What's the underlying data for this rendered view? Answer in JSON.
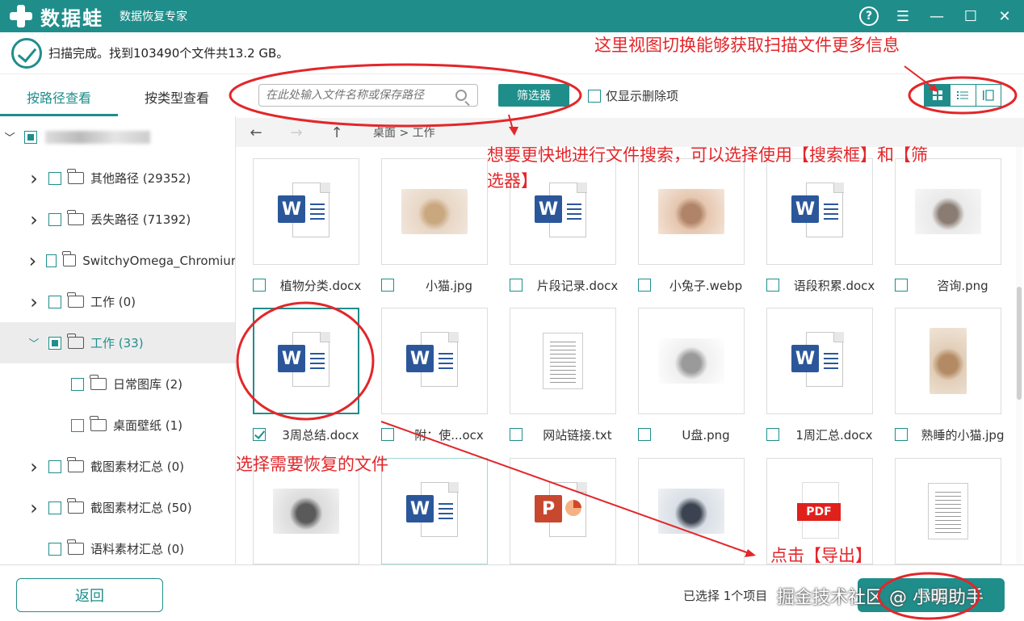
{
  "app": {
    "logo_text": "数据蛙",
    "subtitle": "数据恢复专家",
    "help_label": "?",
    "menu_label": "☰",
    "minimize_label": "—",
    "maximize_label": "☐",
    "close_label": "✕"
  },
  "status": {
    "text": "扫描完成。找到103490个文件共13.2 GB。"
  },
  "left_tabs": [
    {
      "label": "按路径查看",
      "active": true
    },
    {
      "label": "按类型查看",
      "active": false
    }
  ],
  "tree": [
    {
      "label": "",
      "level": 0,
      "expanded": true,
      "check": "partial",
      "blurred": true
    },
    {
      "label": "其他路径 (29352)",
      "level": 1,
      "expanded": false,
      "check": "none"
    },
    {
      "label": "丢失路径 (71392)",
      "level": 1,
      "expanded": false,
      "check": "none"
    },
    {
      "label": "SwitchyOmega_Chromiur",
      "level": 1,
      "expanded": false,
      "check": "none"
    },
    {
      "label": "工作 (0)",
      "level": 1,
      "expanded": false,
      "check": "none"
    },
    {
      "label": "工作 (33)",
      "level": 1,
      "expanded": true,
      "check": "partial",
      "selected": true
    },
    {
      "label": "日常图库 (2)",
      "level": 2,
      "check": "none"
    },
    {
      "label": "桌面壁纸 (1)",
      "level": 2,
      "check": "none"
    },
    {
      "label": "截图素材汇总 (0)",
      "level": 1,
      "expanded": false,
      "check": "none"
    },
    {
      "label": "截图素材汇总 (50)",
      "level": 1,
      "expanded": false,
      "check": "none"
    },
    {
      "label": "语料素材汇总 (0)",
      "level": 1,
      "check": "none"
    }
  ],
  "toolbar": {
    "search_placeholder": "在此处输入文件名称或保存路径",
    "filter_label": "筛选器",
    "deleted_only_label": "仅显示删除项"
  },
  "nav": {
    "back": "←",
    "forward": "→",
    "up": "↑",
    "breadcrumb": "桌面 > 工作"
  },
  "files": [
    {
      "name": "植物分类.docx",
      "type": "word",
      "checked": false
    },
    {
      "name": "小猫.jpg",
      "type": "photo",
      "colors": [
        "#e8d7c6",
        "#c9a77f",
        "#f2e8de"
      ],
      "checked": false
    },
    {
      "name": "片段记录.docx",
      "type": "word",
      "checked": false
    },
    {
      "name": "小兔子.webp",
      "type": "photo",
      "colors": [
        "#e6c7b0",
        "#b08468",
        "#f4e6da"
      ],
      "checked": false
    },
    {
      "name": "语段积累.docx",
      "type": "word",
      "checked": false
    },
    {
      "name": "咨询.png",
      "type": "photo",
      "colors": [
        "#eaeaea",
        "#8a7c72",
        "#f6f6f6"
      ],
      "checked": false
    },
    {
      "name": "3周总结.docx",
      "type": "word",
      "checked": true,
      "selected": true
    },
    {
      "name": "附：使...ocx",
      "type": "word",
      "checked": false
    },
    {
      "name": "网站链接.txt",
      "type": "txt",
      "checked": false
    },
    {
      "name": "U盘.png",
      "type": "photo",
      "colors": [
        "#f0f0f0",
        "#9a9a9a",
        "#ffffff"
      ],
      "checked": false
    },
    {
      "name": "1周汇总.docx",
      "type": "word",
      "checked": false
    },
    {
      "name": "熟睡的小猫.jpg",
      "type": "photo",
      "colors": [
        "#e2cfba",
        "#b38a63",
        "#f0e4d6"
      ],
      "checked": false
    },
    {
      "name": "",
      "type": "photo",
      "colors": [
        "#dcdcdc",
        "#5a5a5a",
        "#f2f2f2"
      ],
      "checked": false
    },
    {
      "name": "",
      "type": "word",
      "checked": false,
      "hover": true
    },
    {
      "name": "",
      "type": "ppt",
      "checked": false
    },
    {
      "name": "",
      "type": "photo",
      "colors": [
        "#d9dfe6",
        "#3b4350",
        "#eef1f4"
      ],
      "checked": false
    },
    {
      "name": "",
      "type": "pdf",
      "checked": false
    },
    {
      "name": "",
      "type": "txt",
      "checked": false
    }
  ],
  "bottom": {
    "back_label": "返回",
    "selection_text": "已选择 1个项目",
    "export_label": "导出",
    "watermark": "掘金技术社区 @ 小明助手"
  },
  "annotations": {
    "view_tip": "这里视图切换能够获取扫描文件更多信息",
    "search_tip_1": "想要更快地进行文件搜索，可以选择使用【搜索框】和【筛",
    "search_tip_2": "选器】",
    "select_tip": "选择需要恢复的文件",
    "export_tip": "点击【导出】"
  },
  "colors": {
    "accent": "#1f8e8b",
    "annotation": "#e3262a"
  }
}
